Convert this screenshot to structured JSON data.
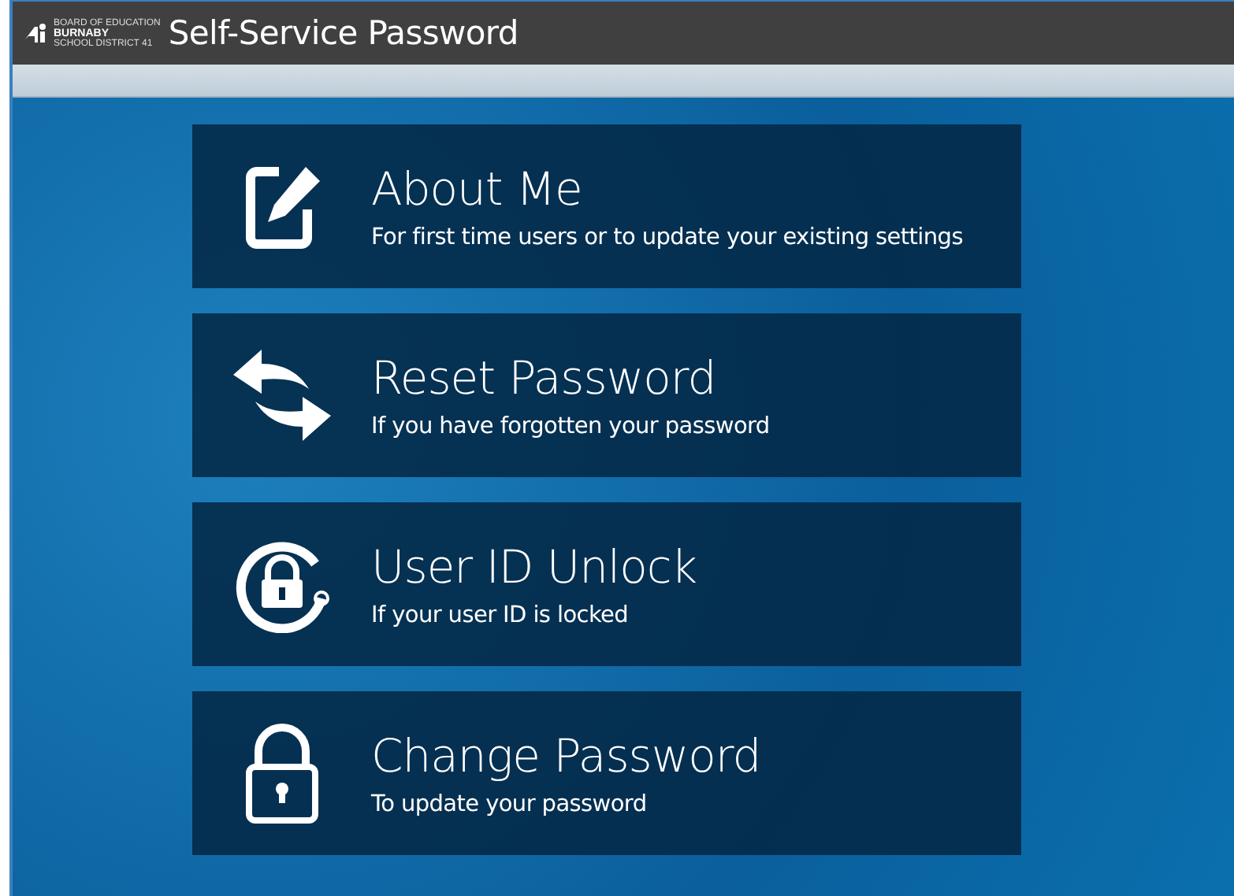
{
  "header": {
    "logo": {
      "line_1": "BOARD OF EDUCATION",
      "line_2": "BURNABY",
      "line_3": "SCHOOL DISTRICT 41"
    },
    "title": "Self-Service Password"
  },
  "options": [
    {
      "kind": "edit",
      "title": "About Me",
      "description": "For first time users or to update your existing settings"
    },
    {
      "kind": "reset",
      "title": "Reset Password",
      "description": "If you have forgotten your password"
    },
    {
      "kind": "unlock",
      "title": "User ID Unlock",
      "description": "If your user ID is locked"
    },
    {
      "kind": "lock",
      "title": "Change Password",
      "description": "To update your password"
    }
  ]
}
